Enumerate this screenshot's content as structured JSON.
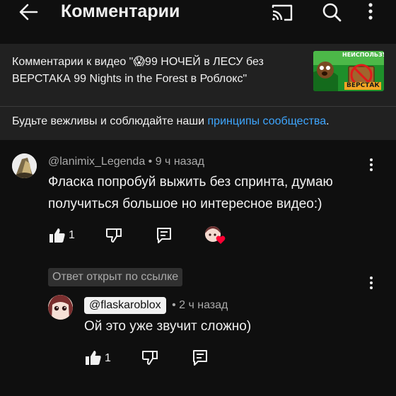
{
  "header": {
    "title": "Комментарии",
    "icons": [
      "back-arrow-icon",
      "cast-icon",
      "search-icon",
      "more-vert-icon"
    ]
  },
  "video": {
    "prefix": "Комментарии к видео \"",
    "emoji": "😱",
    "title": "99 НОЧЕЙ в ЛЕСУ без ВЕРСТАКА 99 Nights in the Forest в Роблокс\"",
    "thumbnail_top_text": "НЕИСПОЛЬЗУЯ",
    "thumbnail_bottom_text": "ВЕРСТАК"
  },
  "rules": {
    "text": "Будьте вежливы и соблюдайте наши ",
    "link": "принципы сообщества",
    "end": "."
  },
  "comment": {
    "author": "@lanimix_Legenda",
    "time": " • 9 ч назад",
    "text": "Фласка попробуй выжить без спринта, думаю получиться большое но интересное видео:)",
    "likes": "1"
  },
  "reply": {
    "highlight_label": "Ответ открыт по ссылке",
    "mention": "@flaskaroblox",
    "time": " • 2 ч назад",
    "text": "Ой это уже звучит сложно)",
    "likes": "1"
  },
  "colors": {
    "background": "#0f0f0f",
    "banner": "#212121",
    "link": "#3ea6ff",
    "meta": "#aaaaaa",
    "heart": "#ff0033"
  }
}
